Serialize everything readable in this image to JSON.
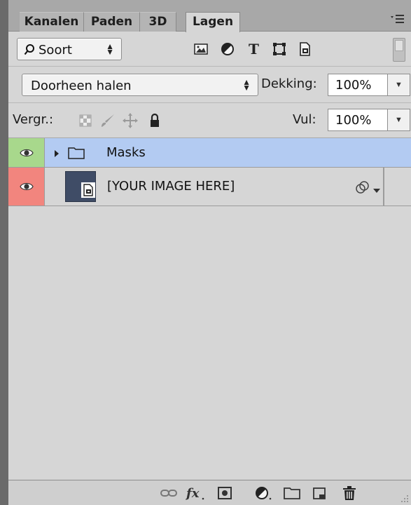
{
  "tabs": [
    {
      "label": "Kanalen",
      "active": false
    },
    {
      "label": "Paden",
      "active": false
    },
    {
      "label": "3D",
      "active": false
    },
    {
      "label": "Lagen",
      "active": true
    }
  ],
  "filter": {
    "kind_label": "Soort",
    "icons": [
      "pixel-filter-icon",
      "adjustment-filter-icon",
      "type-filter-icon",
      "shape-filter-icon",
      "smart-object-filter-icon"
    ]
  },
  "blend": {
    "mode": "Doorheen halen",
    "opacity_label": "Dekking:",
    "opacity_value": "100%"
  },
  "locks": {
    "label": "Vergr.:",
    "fill_label": "Vul:",
    "fill_value": "100%",
    "icons": [
      "lock-transparent-pixels-icon",
      "lock-image-pixels-icon",
      "lock-position-icon",
      "lock-all-icon"
    ]
  },
  "layers": [
    {
      "name": "Masks",
      "type": "group",
      "visible": true,
      "color": "#a8d88c",
      "row_bg": "#b3cbf2"
    },
    {
      "name": "[YOUR IMAGE HERE]",
      "type": "smart-object",
      "visible": true,
      "color": "#f2857e",
      "row_bg": "#d6d6d6",
      "thumb_color": "#3f4c66"
    }
  ],
  "bottom_icons": [
    "link-layers-icon",
    "fx-icon",
    "add-mask-icon",
    "adjustment-layer-icon",
    "new-group-icon",
    "new-layer-icon",
    "delete-icon"
  ],
  "colors": {
    "panel_bg": "#d6d6d6",
    "selected_row": "#b3cbf2",
    "group_eye_cell": "#a8d88c",
    "image_eye_cell": "#f2857e"
  }
}
